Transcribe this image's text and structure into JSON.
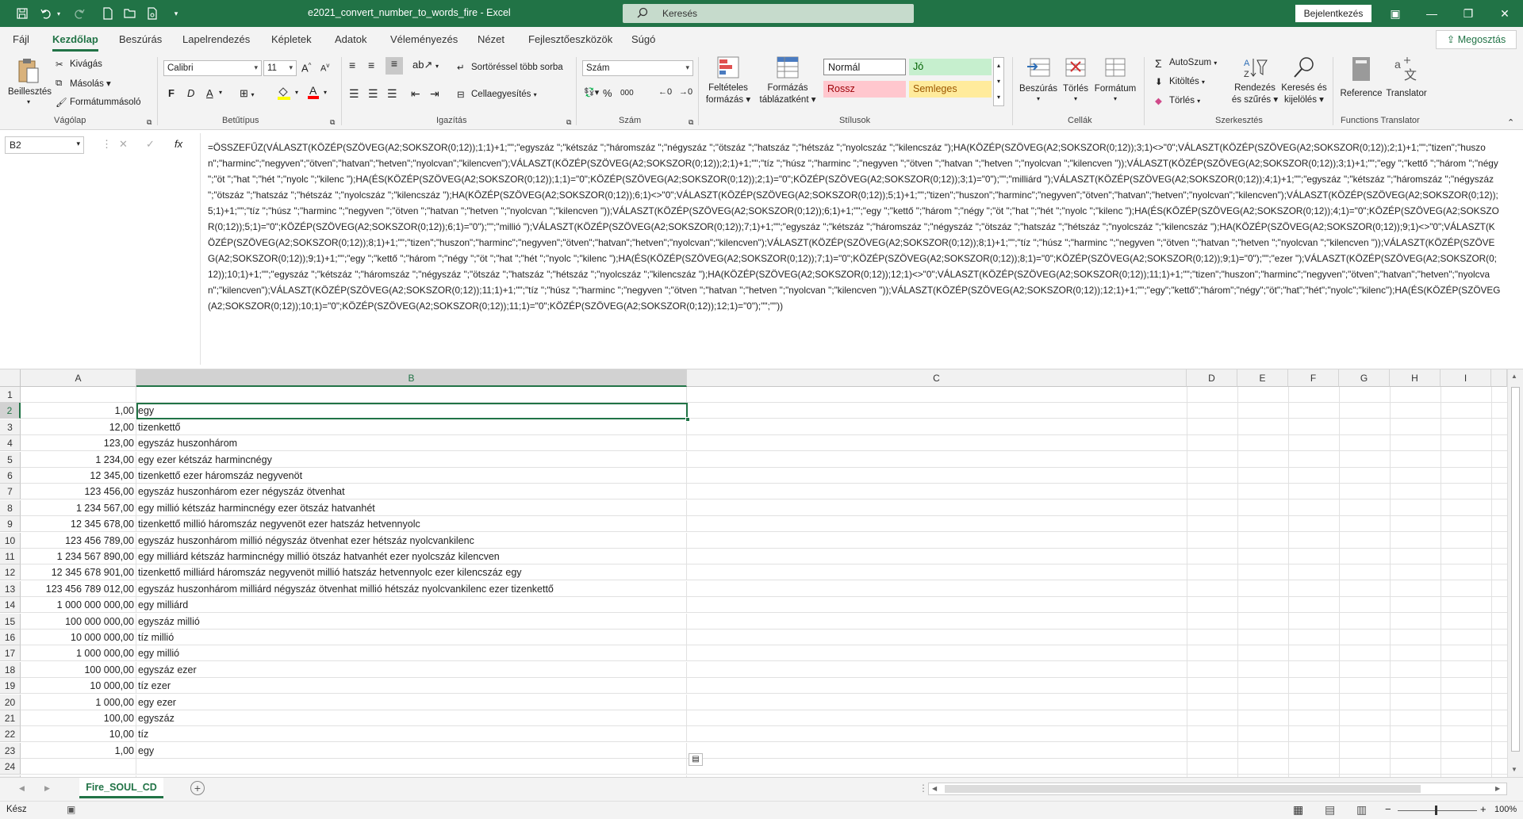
{
  "app": {
    "title": "e2021_convert_number_to_words_fire  -  Excel",
    "search_placeholder": "Keresés",
    "signin_label": "Bejelentkezés",
    "share_label": "Megosztás"
  },
  "menu": {
    "tabs": [
      "Fájl",
      "Kezdőlap",
      "Beszúrás",
      "Lapelrendezés",
      "Képletek",
      "Adatok",
      "Véleményezés",
      "Nézet",
      "Fejlesztőeszközök",
      "Súgó"
    ]
  },
  "ribbon": {
    "clipboard": {
      "paste": "Beillesztés",
      "cut": "Kivágás",
      "copy": "Másolás",
      "format_painter": "Formátummásoló",
      "label": "Vágólap"
    },
    "font": {
      "name": "Calibri",
      "size": "11",
      "bold": "F",
      "italic": "D",
      "underline": "A",
      "label": "Betűtípus"
    },
    "alignment": {
      "wrap": "Sortöréssel több sorba",
      "merge": "Cellaegyesítés",
      "label": "Igazítás"
    },
    "number": {
      "format": "Szám",
      "label": "Szám"
    },
    "styles": {
      "conditional_1": "Feltételes",
      "conditional_2": "formázás",
      "table_1": "Formázás",
      "table_2": "táblázatként",
      "normal": "Normál",
      "good": "Jó",
      "bad": "Rossz",
      "neutral": "Semleges",
      "label": "Stílusok"
    },
    "cells": {
      "insert": "Beszúrás",
      "delete": "Törlés",
      "format": "Formátum",
      "label": "Cellák"
    },
    "editing": {
      "autosum": "AutoSzum",
      "fill": "Kitöltés",
      "clear": "Törlés",
      "sort_1": "Rendezés",
      "sort_2": "és szűrés",
      "find_1": "Keresés és",
      "find_2": "kijelölés",
      "label": "Szerkesztés"
    },
    "translator": {
      "reference": "Reference",
      "translator": "Translator",
      "label": "Functions Translator"
    }
  },
  "formula_bar": {
    "name_box": "B2",
    "fx": "fx",
    "formula": "=ÖSSZEFŰZ(VÁLASZT(KÖZÉP(SZÖVEG(A2;SOKSZOR(0;12));1;1)+1;\"\";\"egyszáz \";\"kétszáz \";\"háromszáz \";\"négyszáz \";\"ötszáz \";\"hatszáz \";\"hétszáz \";\"nyolcszáz \";\"kilencszáz \");HA(KÖZÉP(SZÖVEG(A2;SOKSZOR(0;12));3;1)<>\"0\";VÁLASZT(KÖZÉP(SZÖVEG(A2;SOKSZOR(0;12));2;1)+1;\"\";\"tizen\";\"huszon\";\"harminc\";\"negyven\";\"ötven\";\"hatvan\";\"hetven\";\"nyolcvan\";\"kilencven\");VÁLASZT(KÖZÉP(SZÖVEG(A2;SOKSZOR(0;12));2;1)+1;\"\";\"tíz \";\"húsz \";\"harminc \";\"negyven \";\"ötven \";\"hatvan \";\"hetven \";\"nyolcvan \";\"kilencven \"));VÁLASZT(KÖZÉP(SZÖVEG(A2;SOKSZOR(0;12));3;1)+1;\"\";\"egy \";\"kettő \";\"három \";\"négy \";\"öt \";\"hat \";\"hét \";\"nyolc \";\"kilenc \");HA(ÉS(KÖZÉP(SZÖVEG(A2;SOKSZOR(0;12));1;1)=\"0\";KÖZÉP(SZÖVEG(A2;SOKSZOR(0;12));2;1)=\"0\";KÖZÉP(SZÖVEG(A2;SOKSZOR(0;12));3;1)=\"0\");\"\";\"milliárd \");VÁLASZT(KÖZÉP(SZÖVEG(A2;SOKSZOR(0;12));4;1)+1;\"\";\"egyszáz \";\"kétszáz \";\"háromszáz \";\"négyszáz \";\"ötszáz \";\"hatszáz \";\"hétszáz \";\"nyolcszáz \";\"kilencszáz \");HA(KÖZÉP(SZÖVEG(A2;SOKSZOR(0;12));6;1)<>\"0\";VÁLASZT(KÖZÉP(SZÖVEG(A2;SOKSZOR(0;12));5;1)+1;\"\";\"tizen\";\"huszon\";\"harminc\";\"negyven\";\"ötven\";\"hatvan\";\"hetven\";\"nyolcvan\";\"kilencven\");VÁLASZT(KÖZÉP(SZÖVEG(A2;SOKSZOR(0;12));5;1)+1;\"\";\"tíz \";\"húsz \";\"harminc \";\"negyven \";\"ötven \";\"hatvan \";\"hetven \";\"nyolcvan \";\"kilencven \"));VÁLASZT(KÖZÉP(SZÖVEG(A2;SOKSZOR(0;12));6;1)+1;\"\";\"egy \";\"kettő \";\"három \";\"négy \";\"öt \";\"hat \";\"hét \";\"nyolc \";\"kilenc \");HA(ÉS(KÖZÉP(SZÖVEG(A2;SOKSZOR(0;12));4;1)=\"0\";KÖZÉP(SZÖVEG(A2;SOKSZOR(0;12));5;1)=\"0\";KÖZÉP(SZÖVEG(A2;SOKSZOR(0;12));6;1)=\"0\");\"\";\"millió \");VÁLASZT(KÖZÉP(SZÖVEG(A2;SOKSZOR(0;12));7;1)+1;\"\";\"egyszáz \";\"kétszáz \";\"háromszáz \";\"négyszáz \";\"ötszáz \";\"hatszáz \";\"hétszáz \";\"nyolcszáz \";\"kilencszáz \");HA(KÖZÉP(SZÖVEG(A2;SOKSZOR(0;12));9;1)<>\"0\";VÁLASZT(KÖZÉP(SZÖVEG(A2;SOKSZOR(0;12));8;1)+1;\"\";\"tizen\";\"huszon\";\"harminc\";\"negyven\";\"ötven\";\"hatvan\";\"hetven\";\"nyolcvan\";\"kilencven\");VÁLASZT(KÖZÉP(SZÖVEG(A2;SOKSZOR(0;12));8;1)+1;\"\";\"tíz \";\"húsz \";\"harminc \";\"negyven \";\"ötven \";\"hatvan \";\"hetven \";\"nyolcvan \";\"kilencven \"));VÁLASZT(KÖZÉP(SZÖVEG(A2;SOKSZOR(0;12));9;1)+1;\"\";\"egy \";\"kettő \";\"három \";\"négy \";\"öt \";\"hat \";\"hét \";\"nyolc \";\"kilenc \");HA(ÉS(KÖZÉP(SZÖVEG(A2;SOKSZOR(0;12));7;1)=\"0\";KÖZÉP(SZÖVEG(A2;SOKSZOR(0;12));8;1)=\"0\";KÖZÉP(SZÖVEG(A2;SOKSZOR(0;12));9;1)=\"0\");\"\";\"ezer \");VÁLASZT(KÖZÉP(SZÖVEG(A2;SOKSZOR(0;12));10;1)+1;\"\";\"egyszáz \";\"kétszáz \";\"háromszáz \";\"négyszáz \";\"ötszáz \";\"hatszáz \";\"hétszáz \";\"nyolcszáz \";\"kilencszáz \");HA(KÖZÉP(SZÖVEG(A2;SOKSZOR(0;12));12;1)<>\"0\";VÁLASZT(KÖZÉP(SZÖVEG(A2;SOKSZOR(0;12));11;1)+1;\"\";\"tizen\";\"huszon\";\"harminc\";\"negyven\";\"ötven\";\"hatvan\";\"hetven\";\"nyolcvan\";\"kilencven\");VÁLASZT(KÖZÉP(SZÖVEG(A2;SOKSZOR(0;12));11;1)+1;\"\";\"tíz \";\"húsz \";\"harminc \";\"negyven \";\"ötven \";\"hatvan \";\"hetven \";\"nyolcvan \";\"kilencven \"));VÁLASZT(KÖZÉP(SZÖVEG(A2;SOKSZOR(0;12));12;1)+1;\"\";\"egy\";\"kettő\";\"három\";\"négy\";\"öt\";\"hat\";\"hét\";\"nyolc\";\"kilenc\");HA(ÉS(KÖZÉP(SZÖVEG(A2;SOKSZOR(0;12));10;1)=\"0\";KÖZÉP(SZÖVEG(A2;SOKSZOR(0;12));11;1)=\"0\";KÖZÉP(SZÖVEG(A2;SOKSZOR(0;12));12;1)=\"0\");\"\";\"\"))"
  },
  "sheet": {
    "columns": [
      "A",
      "B",
      "C",
      "D",
      "E",
      "F",
      "G",
      "H",
      "I"
    ],
    "rows": [
      {
        "n": "1",
        "a": "",
        "b": ""
      },
      {
        "n": "2",
        "a": "1,00",
        "b": "egy"
      },
      {
        "n": "3",
        "a": "12,00",
        "b": "tizenkettő"
      },
      {
        "n": "4",
        "a": "123,00",
        "b": "egyszáz huszonhárom"
      },
      {
        "n": "5",
        "a": "1 234,00",
        "b": "egy ezer kétszáz harmincnégy"
      },
      {
        "n": "6",
        "a": "12 345,00",
        "b": "tizenkettő ezer háromszáz negyvenöt"
      },
      {
        "n": "7",
        "a": "123 456,00",
        "b": "egyszáz huszonhárom ezer négyszáz ötvenhat"
      },
      {
        "n": "8",
        "a": "1 234 567,00",
        "b": "egy millió kétszáz harmincnégy ezer ötszáz hatvanhét"
      },
      {
        "n": "9",
        "a": "12 345 678,00",
        "b": "tizenkettő millió háromszáz negyvenöt ezer hatszáz hetvennyolc"
      },
      {
        "n": "10",
        "a": "123 456 789,00",
        "b": "egyszáz huszonhárom millió négyszáz ötvenhat ezer hétszáz nyolcvankilenc"
      },
      {
        "n": "11",
        "a": "1 234 567 890,00",
        "b": "egy milliárd kétszáz harmincnégy millió ötszáz hatvanhét ezer nyolcszáz kilencven"
      },
      {
        "n": "12",
        "a": "12 345 678 901,00",
        "b": "tizenkettő milliárd háromszáz negyvenöt millió hatszáz hetvennyolc ezer kilencszáz egy"
      },
      {
        "n": "13",
        "a": "123 456 789 012,00",
        "b": "egyszáz huszonhárom milliárd négyszáz ötvenhat millió hétszáz nyolcvankilenc ezer tizenkettő"
      },
      {
        "n": "14",
        "a": "1 000 000 000,00",
        "b": "egy milliárd"
      },
      {
        "n": "15",
        "a": "100 000 000,00",
        "b": "egyszáz millió"
      },
      {
        "n": "16",
        "a": "10 000 000,00",
        "b": "tíz millió"
      },
      {
        "n": "17",
        "a": "1 000 000,00",
        "b": "egy millió"
      },
      {
        "n": "18",
        "a": "100 000,00",
        "b": "egyszáz ezer"
      },
      {
        "n": "19",
        "a": "10 000,00",
        "b": "tíz ezer"
      },
      {
        "n": "20",
        "a": "1 000,00",
        "b": "egy ezer"
      },
      {
        "n": "21",
        "a": "100,00",
        "b": "egyszáz"
      },
      {
        "n": "22",
        "a": "10,00",
        "b": "tíz"
      },
      {
        "n": "23",
        "a": "1,00",
        "b": "egy"
      },
      {
        "n": "24",
        "a": "",
        "b": ""
      },
      {
        "n": "25",
        "a": "",
        "b": ""
      }
    ]
  },
  "sheet_tabs": {
    "active": "Fire_SOUL_CD"
  },
  "status": {
    "ready": "Kész",
    "zoom": "100%"
  },
  "colors": {
    "accent": "#217346",
    "good_bg": "#c6efce",
    "bad_bg": "#ffc7ce",
    "neutral_bg": "#ffeb9c"
  }
}
